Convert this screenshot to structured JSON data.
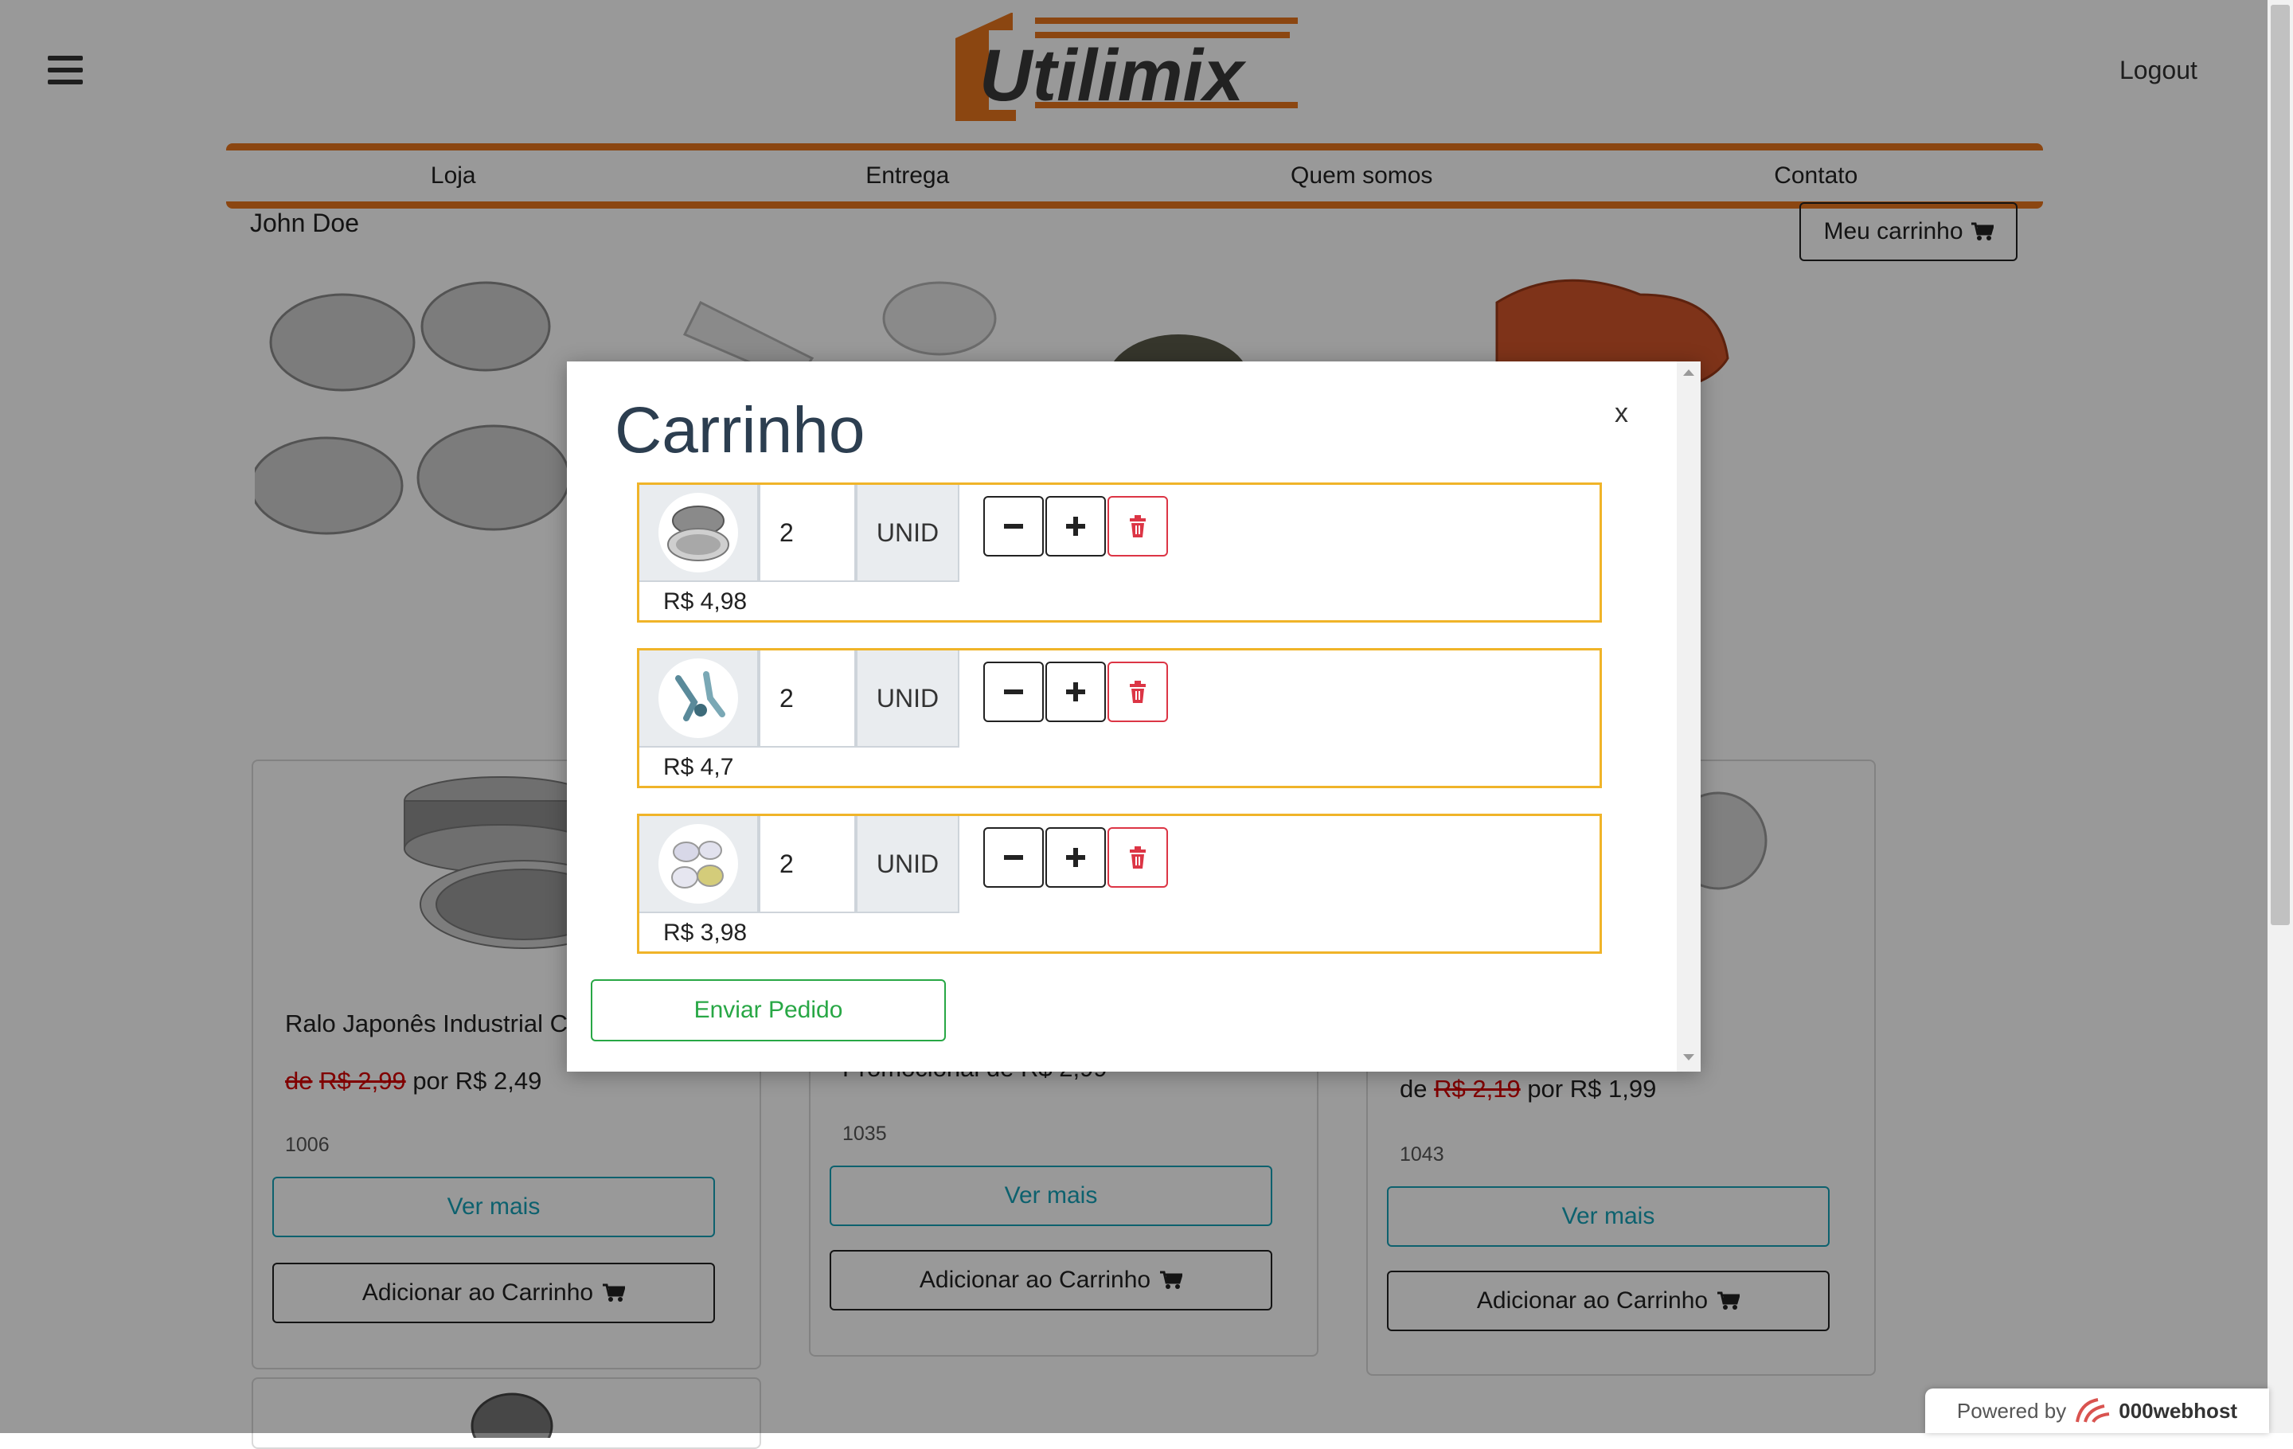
{
  "header": {
    "logo_text": "Utilimix",
    "logout_label": "Logout",
    "user_name": "John Doe",
    "cart_button_label": "Meu carrinho",
    "colors": {
      "brand_orange": "#e8761d",
      "brand_dark": "#3a3a3a"
    }
  },
  "nav": {
    "items": [
      {
        "label": "Loja"
      },
      {
        "label": "Entrega"
      },
      {
        "label": "Quem somos"
      },
      {
        "label": "Contato"
      }
    ]
  },
  "products": [
    {
      "title": "Ralo Japonês Industrial C",
      "price_prefix": "de",
      "old_price": "R$ 2,99",
      "price_mid": "por",
      "new_price": "R$ 2,49",
      "code": "1006",
      "details_label": "Ver mais",
      "add_label": "Adicionar ao Carrinho"
    },
    {
      "title": "Promocional de R$ 2,99",
      "code": "1035",
      "details_label": "Ver mais",
      "add_label": "Adicionar ao Carrinho"
    },
    {
      "price_prefix": "de",
      "old_price": "R$ 2,19",
      "price_mid": "por",
      "new_price": "R$ 1,99",
      "code": "1043",
      "details_label": "Ver mais",
      "add_label": "Adicionar ao Carrinho"
    }
  ],
  "modal": {
    "title": "Carrinho",
    "close_label": "x",
    "items": [
      {
        "quantity": "2",
        "unit": "UNID",
        "price": "R$ 4,98",
        "thumb_icon": "strainer-icon"
      },
      {
        "quantity": "2",
        "unit": "UNID",
        "price": "R$ 4,7",
        "thumb_icon": "clips-icon"
      },
      {
        "quantity": "2",
        "unit": "UNID",
        "price": "R$ 3,98",
        "thumb_icon": "caps-icon"
      }
    ],
    "send_label": "Enviar Pedido",
    "colors": {
      "item_border": "#f0b429",
      "send": "#28a745",
      "delete": "#dc3545"
    }
  },
  "footer": {
    "powered_prefix": "Powered by",
    "powered_brand": "000webhost"
  }
}
